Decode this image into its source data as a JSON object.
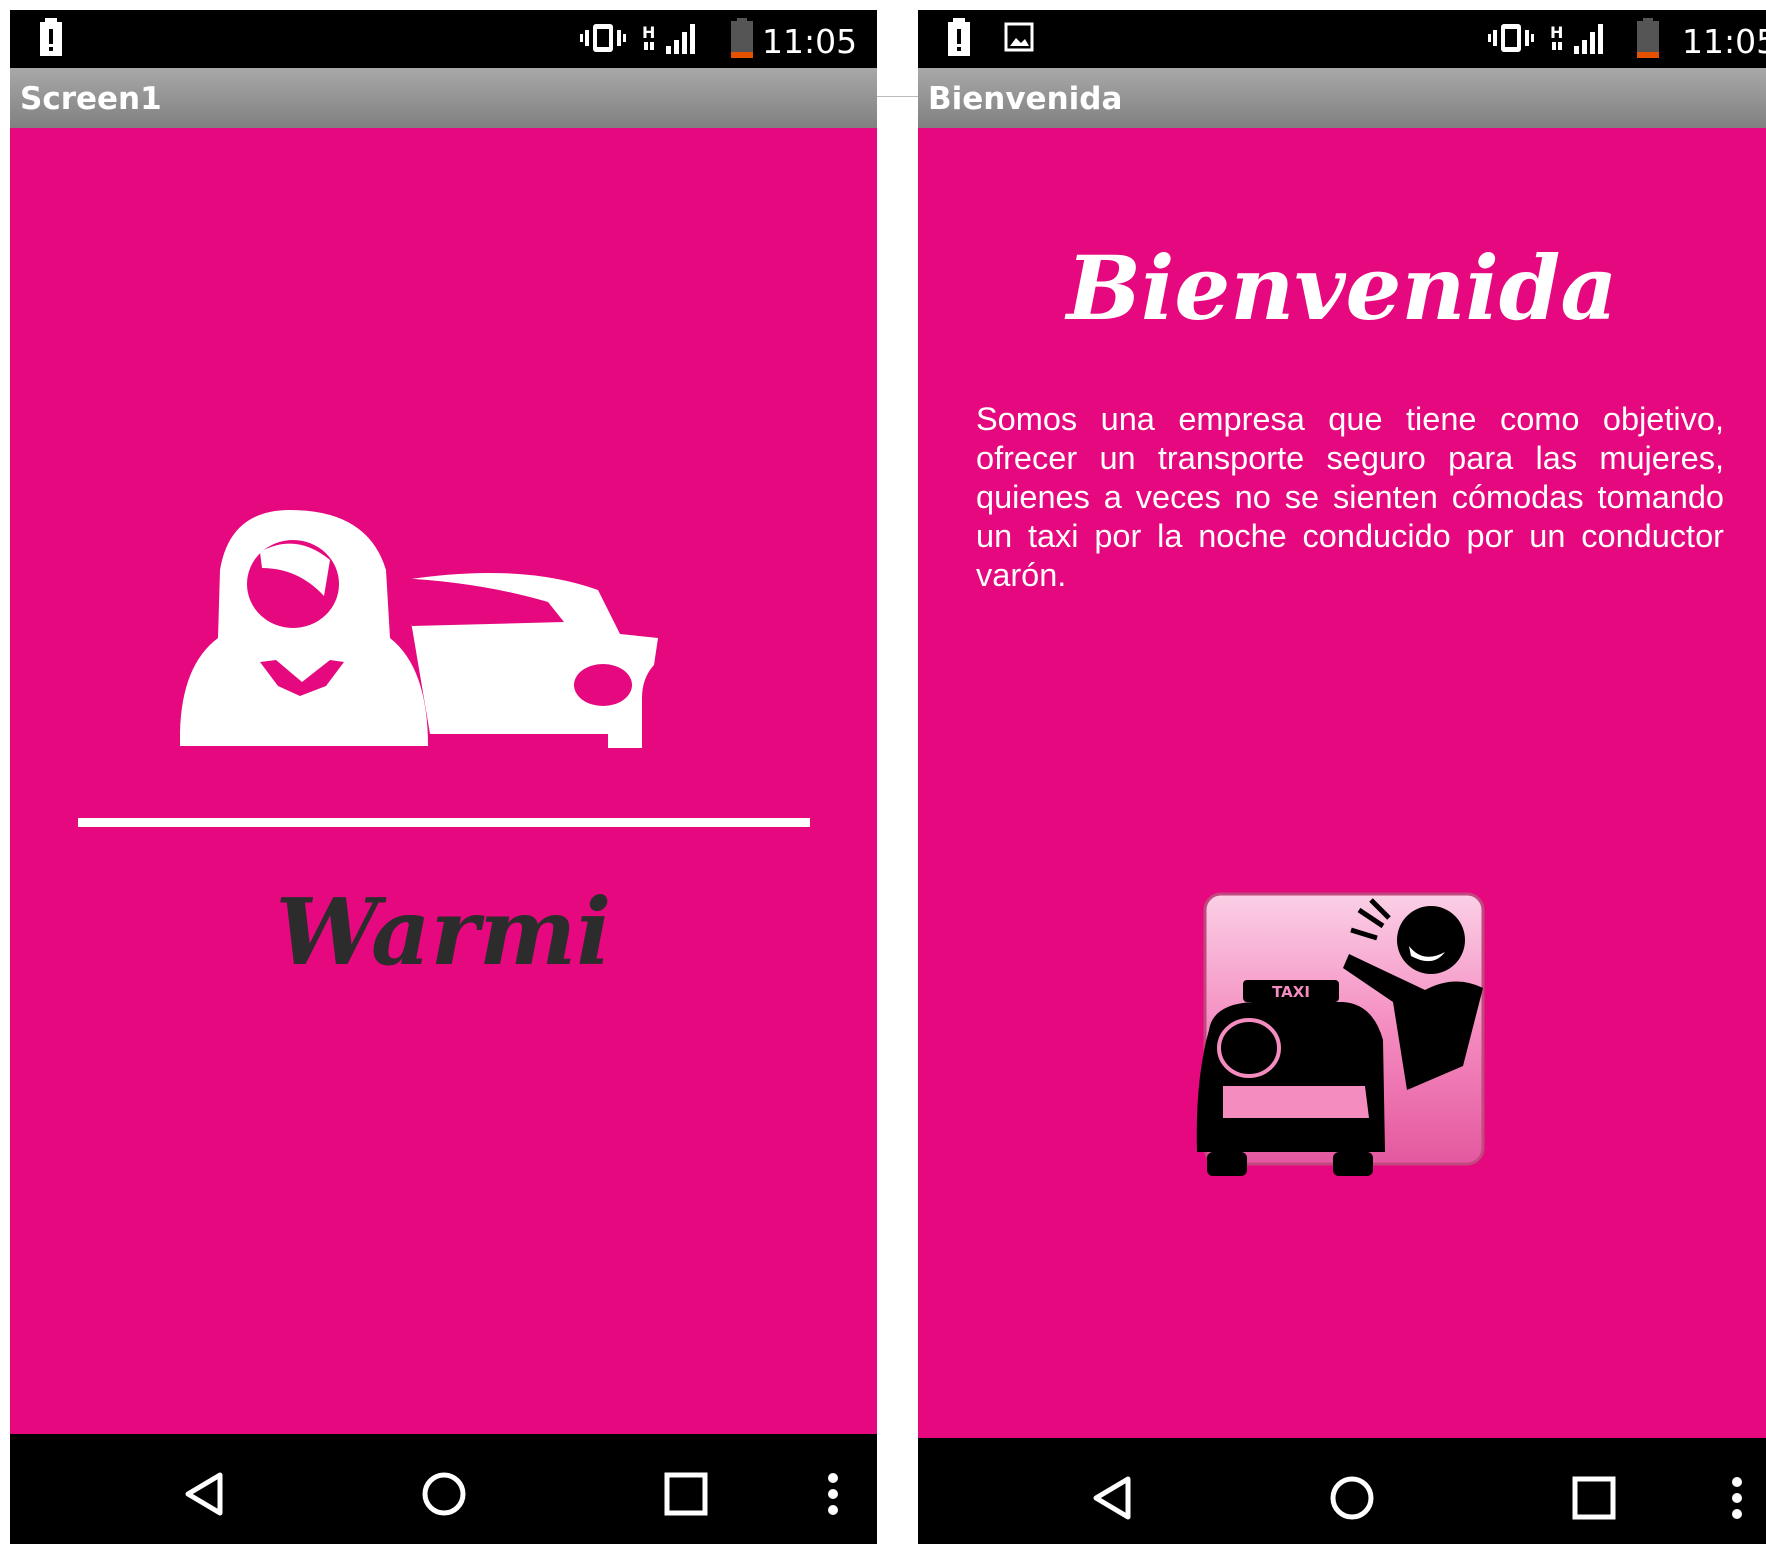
{
  "status_bar": {
    "time": "11:05"
  },
  "screens": [
    {
      "title": "Screen1",
      "app_name": "Warmi",
      "logo_icon": "woman-and-car-icon"
    },
    {
      "title": "Bienvenida",
      "heading": "Bienvenida",
      "description": "Somos una empresa que tiene como objetivo, ofrecer un transporte seguro para las mujeres, quienes a veces no se sienten cómodas tomando un taxi por la noche conducido por un conductor varón.",
      "button_icon": "hail-taxi-icon",
      "taxi_sign": "TAXI"
    }
  ],
  "nav_bar": {
    "icons": [
      "back-icon",
      "home-icon",
      "recents-icon",
      "menu-icon"
    ]
  },
  "colors": {
    "background": "#e5087e",
    "title_bar": "#9a9a9a",
    "system_bars": "#000000",
    "warmi_text": "#2c2c2c"
  }
}
